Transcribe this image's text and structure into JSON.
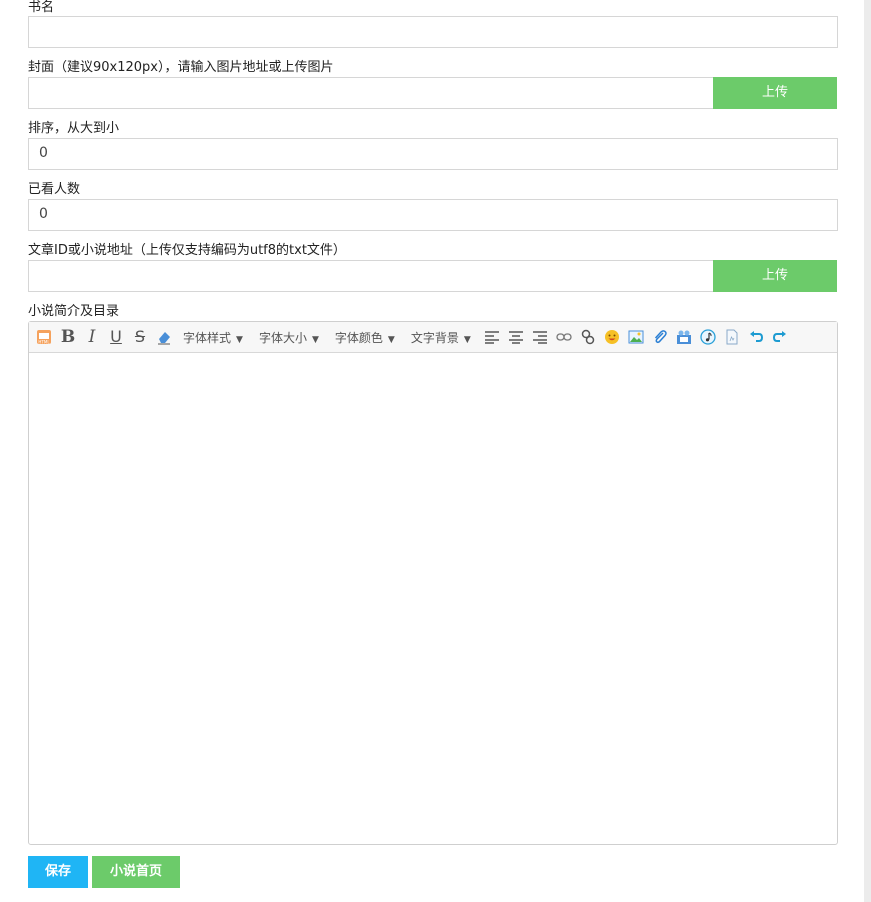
{
  "fields": {
    "book_name": {
      "label": "书名",
      "value": ""
    },
    "cover": {
      "label": "封面（建议90x120px），请输入图片地址或上传图片",
      "value": "",
      "upload_label": "上传"
    },
    "sort": {
      "label": "排序，从大到小",
      "value": "0"
    },
    "viewers": {
      "label": "已看人数",
      "value": "0"
    },
    "article": {
      "label": "文章ID或小说地址（上传仅支持编码为utf8的txt文件）",
      "value": "",
      "upload_label": "上传"
    },
    "intro": {
      "label": "小说简介及目录"
    }
  },
  "toolbar": {
    "font_style": "字体样式",
    "font_size": "字体大小",
    "font_color": "字体颜色",
    "text_bg": "文字背景",
    "dropdown_arrow": "▼"
  },
  "actions": {
    "save_label": "保存",
    "home_label": "小说首页"
  },
  "colors": {
    "upload_green": "#6ccb6a",
    "save_blue": "#1fb5f5",
    "home_green": "#6ccb6a"
  }
}
